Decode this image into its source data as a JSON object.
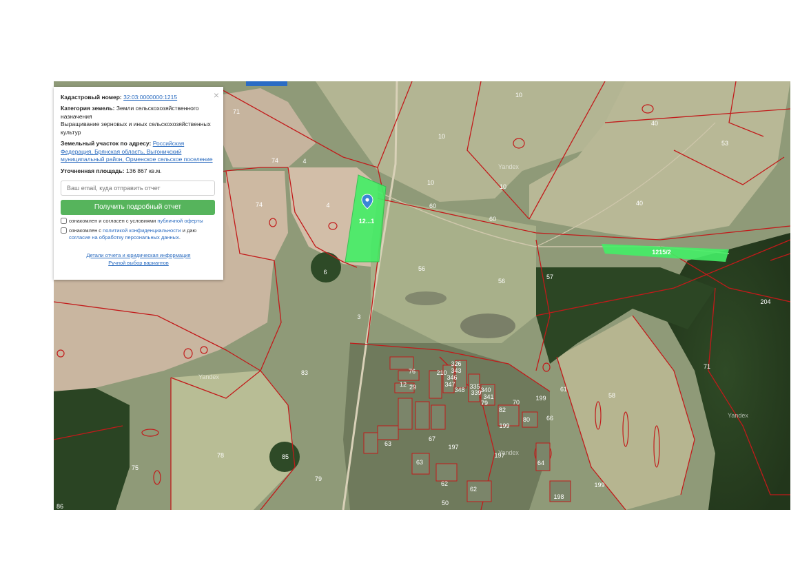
{
  "popup": {
    "close_label": "×",
    "cadastral_label": "Кадастровый номер:",
    "cadastral_number": "32:03:0000000:1215",
    "category_label": "Категория земель:",
    "category_value": "Земли сельскохозяйственного назначения",
    "usage": "Выращивание зерновых и иных сельскохозяйственных культур",
    "address_label": "Земельный участок по адресу:",
    "address_value": "Российская Федерация, Брянская область, Выгоничский муниципальный район, Орменское сельское поселение",
    "area_label": "Уточненная площадь:",
    "area_value": "136 867 кв.м.",
    "email_placeholder": "Ваш email, куда отправить отчет",
    "submit_label": "Получить подробный отчет",
    "consent1_prefix": "ознакомлен и согласен с условиями",
    "consent1_link": "публичной оферты",
    "consent2_prefix": "ознакомлен с",
    "consent2_link1": "политикой конфиденциальности",
    "consent2_mid": "и даю",
    "consent2_link2": "согласие на обработку персональных данных",
    "consent2_suffix": ".",
    "link_details": "Детали отчета и юридическая информация",
    "link_manual": "Ручной выбор вариантов"
  },
  "map": {
    "selected_plot_label": "12...1",
    "highlighted_plot_label": "1215/2",
    "watermark": "Yandex",
    "plot_labels": [
      "10",
      "10",
      "10",
      "10",
      "40",
      "40",
      "53",
      "71",
      "74",
      "74",
      "4",
      "4",
      "60",
      "60",
      "56",
      "56",
      "57",
      "204",
      "6",
      "3",
      "71",
      "61",
      "58",
      "83",
      "76",
      "326",
      "343",
      "346",
      "347",
      "348",
      "210",
      "12",
      "29",
      "335",
      "339",
      "340",
      "341",
      "199",
      "79",
      "70",
      "82",
      "80",
      "66",
      "199",
      "67",
      "63",
      "63",
      "197",
      "197",
      "62",
      "62",
      "199",
      "198",
      "64",
      "50",
      "78",
      "85",
      "75",
      "79",
      "86"
    ],
    "colors": {
      "boundary": "#c21a1a",
      "selected_fill": "#44ee66",
      "marker": "#3a86d6",
      "popup_button": "#56b45c",
      "link": "#2a6bbf"
    }
  }
}
